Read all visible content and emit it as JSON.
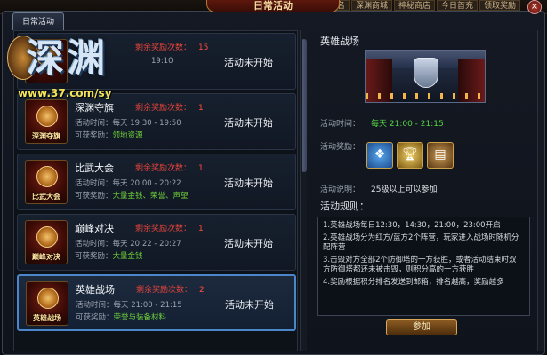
{
  "header": {
    "title": "日常活动",
    "close": "×",
    "nav": [
      "排名",
      "深渊商城",
      "神秘商店",
      "今日首充",
      "领取奖励"
    ]
  },
  "tabs": {
    "daily": "日常活动"
  },
  "logo": {
    "text": "深渊",
    "url": "www.37.com/sy"
  },
  "labels": {
    "remain": "剩余奖励次数：",
    "time": "活动时间：",
    "reward": "可获奖励："
  },
  "activities": [
    {
      "name": "",
      "icon_label": "",
      "remain": "15",
      "time": "19:10",
      "reward": "",
      "status": "活动未开始"
    },
    {
      "name": "深渊夺旗",
      "icon_label": "深渊夺旗",
      "remain": "1",
      "time": "每天 19:30 - 19:50",
      "reward": "领地资源",
      "status": "活动未开始"
    },
    {
      "name": "比武大会",
      "icon_label": "比武大会",
      "remain": "1",
      "time": "每天 20:00 - 20:22",
      "reward": "大量金钱、荣誉、声望",
      "status": "活动未开始"
    },
    {
      "name": "巅峰对决",
      "icon_label": "巅峰对决",
      "remain": "1",
      "time": "每天 20:22 - 20:27",
      "reward": "大量金钱",
      "status": "活动未开始"
    },
    {
      "name": "英雄战场",
      "icon_label": "英雄战场",
      "remain": "2",
      "time": "每天 21:00 - 21:15",
      "reward": "荣誉与装备材料",
      "status": "活动未开始"
    }
  ],
  "detail": {
    "title": "英雄战场",
    "time_label": "活动时间：",
    "time_value": "每天  21:00 - 21:15",
    "reward_label": "活动奖励：",
    "desc_label": "活动说明：",
    "desc_value": "25级以上可以参加",
    "rules_title": "活动规则：",
    "rules": [
      "1.英雄战场每日12:30，14:30，21:00，23:00开启",
      "2.英雄战场分为红方/蓝方2个阵营，玩家进入战场时随机分配阵营",
      "3.击毁对方全部2个防御塔的一方获胜，或者活动结束时双方防御塔都还未被击毁，则积分高的一方获胜",
      "4.奖励根据积分排名发送到邮箱，排名越高，奖励越多"
    ],
    "join_label": "参加"
  }
}
